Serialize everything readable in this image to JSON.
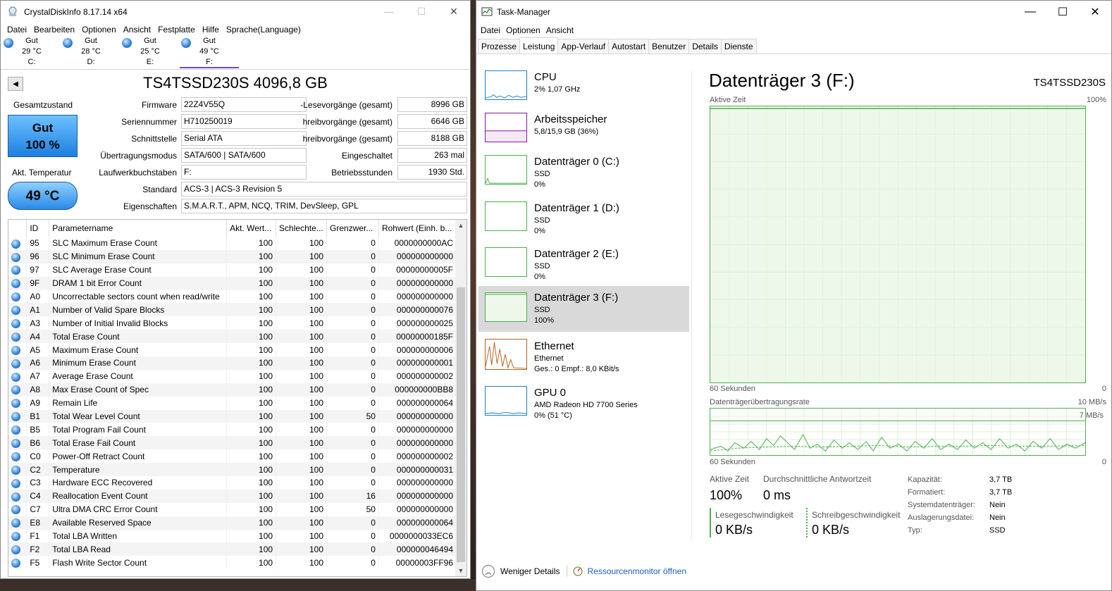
{
  "cdi": {
    "title": "CrystalDiskInfo 8.17.14 x64",
    "menu": [
      "Datei",
      "Bearbeiten",
      "Optionen",
      "Ansicht",
      "Festplatte",
      "Hilfe",
      "Sprache(Language)"
    ],
    "drives": [
      {
        "status": "Gut",
        "temp": "29 °C",
        "letter": "C:"
      },
      {
        "status": "Gut",
        "temp": "28 °C",
        "letter": "D:"
      },
      {
        "status": "Gut",
        "temp": "25 °C",
        "letter": "E:"
      },
      {
        "status": "Gut",
        "temp": "49 °C",
        "letter": "F:"
      }
    ],
    "model": "TS4TSSD230S 4096,8 GB",
    "health_label": "Gesamtzustand",
    "health_status": "Gut",
    "health_pct": "100 %",
    "temp_label": "Akt. Temperatur",
    "temp_value": "49 °C",
    "info": {
      "firmware_l": "Firmware",
      "firmware": "22Z4V55Q",
      "serial_l": "Seriennummer",
      "serial": "H710250019",
      "iface_l": "Schnittstelle",
      "iface": "Serial ATA",
      "mode_l": "Übertragungsmodus",
      "mode": "SATA/600 | SATA/600",
      "letters_l": "Laufwerkbuchstaben",
      "letters": "F:",
      "std_l": "Standard",
      "std": "ACS-3 | ACS-3 Revision 5",
      "feat_l": "Eigenschaften",
      "feat": "S.M.A.R.T., APM, NCQ, TRIM, DevSleep, GPL",
      "reads_l": "-Lesevorgänge (gesamt)",
      "reads": "8996 GB",
      "writes1_l": "hreibvorgänge (gesamt)",
      "writes1": "6646 GB",
      "writes2_l": "hreibvorgänge (gesamt)",
      "writes2": "8188 GB",
      "power_l": "Eingeschaltet",
      "power": "263 mal",
      "hours_l": "Betriebsstunden",
      "hours": "1930 Std."
    },
    "cols": [
      "ID",
      "Parametername",
      "Akt. Wert...",
      "Schlechte...",
      "Grenzwer...",
      "Rohwert (Einh. b..."
    ],
    "rows": [
      [
        "95",
        "SLC Maximum Erase Count",
        "100",
        "100",
        "0",
        "0000000000AC"
      ],
      [
        "96",
        "SLC Minimum Erase Count",
        "100",
        "100",
        "0",
        "000000000000"
      ],
      [
        "97",
        "SLC Average Erase Count",
        "100",
        "100",
        "0",
        "00000000005F"
      ],
      [
        "9F",
        "DRAM 1 bit Error Count",
        "100",
        "100",
        "0",
        "000000000000"
      ],
      [
        "A0",
        "Uncorrectable sectors count when read/write",
        "100",
        "100",
        "0",
        "000000000000"
      ],
      [
        "A1",
        "Number of Valid Spare Blocks",
        "100",
        "100",
        "0",
        "000000000076"
      ],
      [
        "A3",
        "Number of Initial Invalid Blocks",
        "100",
        "100",
        "0",
        "000000000025"
      ],
      [
        "A4",
        "Total Erase Count",
        "100",
        "100",
        "0",
        "00000000185F"
      ],
      [
        "A5",
        "Maximum Erase Count",
        "100",
        "100",
        "0",
        "000000000006"
      ],
      [
        "A6",
        "Minimum Erase Count",
        "100",
        "100",
        "0",
        "000000000001"
      ],
      [
        "A7",
        "Average Erase Count",
        "100",
        "100",
        "0",
        "000000000002"
      ],
      [
        "A8",
        "Max Erase Count of Spec",
        "100",
        "100",
        "0",
        "000000000BB8"
      ],
      [
        "A9",
        "Remain Life",
        "100",
        "100",
        "0",
        "000000000064"
      ],
      [
        "B1",
        "Total Wear Level Count",
        "100",
        "100",
        "50",
        "000000000000"
      ],
      [
        "B5",
        "Total Program Fail Count",
        "100",
        "100",
        "0",
        "000000000000"
      ],
      [
        "B6",
        "Total Erase Fail Count",
        "100",
        "100",
        "0",
        "000000000000"
      ],
      [
        "C0",
        "Power-Off Retract Count",
        "100",
        "100",
        "0",
        "000000000002"
      ],
      [
        "C2",
        "Temperature",
        "100",
        "100",
        "0",
        "000000000031"
      ],
      [
        "C3",
        "Hardware ECC Recovered",
        "100",
        "100",
        "0",
        "000000000000"
      ],
      [
        "C4",
        "Reallocation Event Count",
        "100",
        "100",
        "16",
        "000000000000"
      ],
      [
        "C7",
        "Ultra DMA CRC Error Count",
        "100",
        "100",
        "50",
        "000000000000"
      ],
      [
        "E8",
        "Available Reserved Space",
        "100",
        "100",
        "0",
        "000000000064"
      ],
      [
        "F1",
        "Total LBA Written",
        "100",
        "100",
        "0",
        "0000000033EC6"
      ],
      [
        "F2",
        "Total LBA Read",
        "100",
        "100",
        "0",
        "000000046494"
      ],
      [
        "F5",
        "Flash Write Sector Count",
        "100",
        "100",
        "0",
        "00000003FF96"
      ]
    ]
  },
  "tm": {
    "title": "Task-Manager",
    "menu": [
      "Datei",
      "Optionen",
      "Ansicht"
    ],
    "tabs": [
      "Prozesse",
      "Leistung",
      "App-Verlauf",
      "Autostart",
      "Benutzer",
      "Details",
      "Dienste"
    ],
    "side": [
      {
        "name": "CPU",
        "l2": "2%  1,07 GHz",
        "l3": ""
      },
      {
        "name": "Arbeitsspeicher",
        "l2": "5,8/15,9 GB (36%)",
        "l3": ""
      },
      {
        "name": "Datenträger 0 (C:)",
        "l2": "SSD",
        "l3": "0%"
      },
      {
        "name": "Datenträger 1 (D:)",
        "l2": "SSD",
        "l3": "0%"
      },
      {
        "name": "Datenträger 2 (E:)",
        "l2": "SSD",
        "l3": "0%"
      },
      {
        "name": "Datenträger 3 (F:)",
        "l2": "SSD",
        "l3": "100%"
      },
      {
        "name": "Ethernet",
        "l2": "Ethernet",
        "l3": "Ges.: 0  Empf.: 8,0 KBit/s"
      },
      {
        "name": "GPU 0",
        "l2": "AMD Radeon HD 7700 Series",
        "l3": "0%  (51 °C)"
      }
    ],
    "heading": "Datenträger 3 (F:)",
    "model": "TS4TSSD230S",
    "g1_label": "Aktive Zeit",
    "g1_max": "100%",
    "g1_time": "60 Sekunden",
    "g1_min": "0",
    "g2_label": "Datenträgerübertragungsrate",
    "g2_max": "10 MB/s",
    "g2_line": "7 MB/s",
    "g2_time": "60 Sekunden",
    "g2_min": "0",
    "active_l": "Aktive Zeit",
    "active": "100%",
    "resp_l": "Durchschnittliche Antwortzeit",
    "resp": "0 ms",
    "read_l": "Lesegeschwindigkeit",
    "read": "0 KB/s",
    "write_l": "Schreibgeschwindigkeit",
    "write": "0 KB/s",
    "props": [
      [
        "Kapazität:",
        "3,7 TB"
      ],
      [
        "Formatiert:",
        "3,7 TB"
      ],
      [
        "Systemdatenträger:",
        "Nein"
      ],
      [
        "Auslagerungsdatei:",
        "Nein"
      ],
      [
        "Typ:",
        "SSD"
      ]
    ],
    "less": "Weniger Details",
    "resmon": "Ressourcenmonitor öffnen"
  }
}
